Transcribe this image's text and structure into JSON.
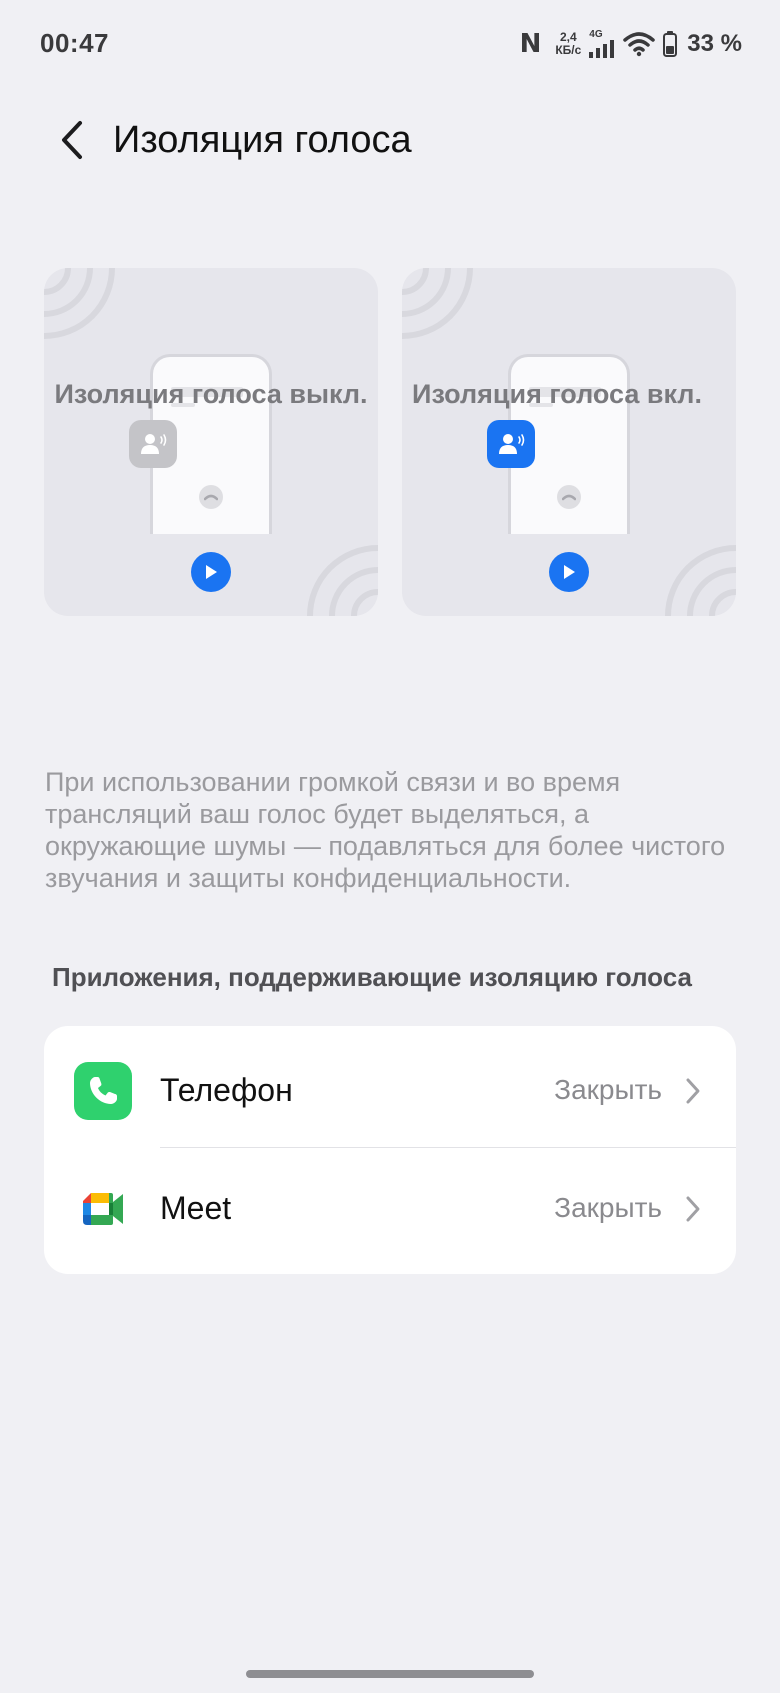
{
  "status_bar": {
    "time": "00:47",
    "nfc": "N",
    "net_speed_value": "2,4",
    "net_speed_unit": "КБ/с",
    "cell_label": "4G",
    "battery": "33 %"
  },
  "header": {
    "title": "Изоляция голоса",
    "back_icon": "chevron-left-icon"
  },
  "previews": [
    {
      "caption": "Изоляция голоса выкл.",
      "state": "off",
      "badge_color": "#c4c4c8"
    },
    {
      "caption": "Изоляция голоса вкл.",
      "state": "on",
      "badge_color": "#1a74f2"
    }
  ],
  "description": "При использовании громкой связи и во время трансляций ваш голос будет выделяться, а окружающие шумы — подавляться для более чистого звучания и защиты конфиденциальности.",
  "section_header": "Приложения, поддерживающие изоляцию голоса",
  "apps": [
    {
      "name": "Телефон",
      "status": "Закрыть",
      "icon": "phone-app-icon",
      "color": "#2fd16e"
    },
    {
      "name": "Meet",
      "status": "Закрыть",
      "icon": "google-meet-icon"
    }
  ],
  "colors": {
    "accent": "#1a74f2",
    "background": "#f0f0f4",
    "card": "#ffffff"
  }
}
